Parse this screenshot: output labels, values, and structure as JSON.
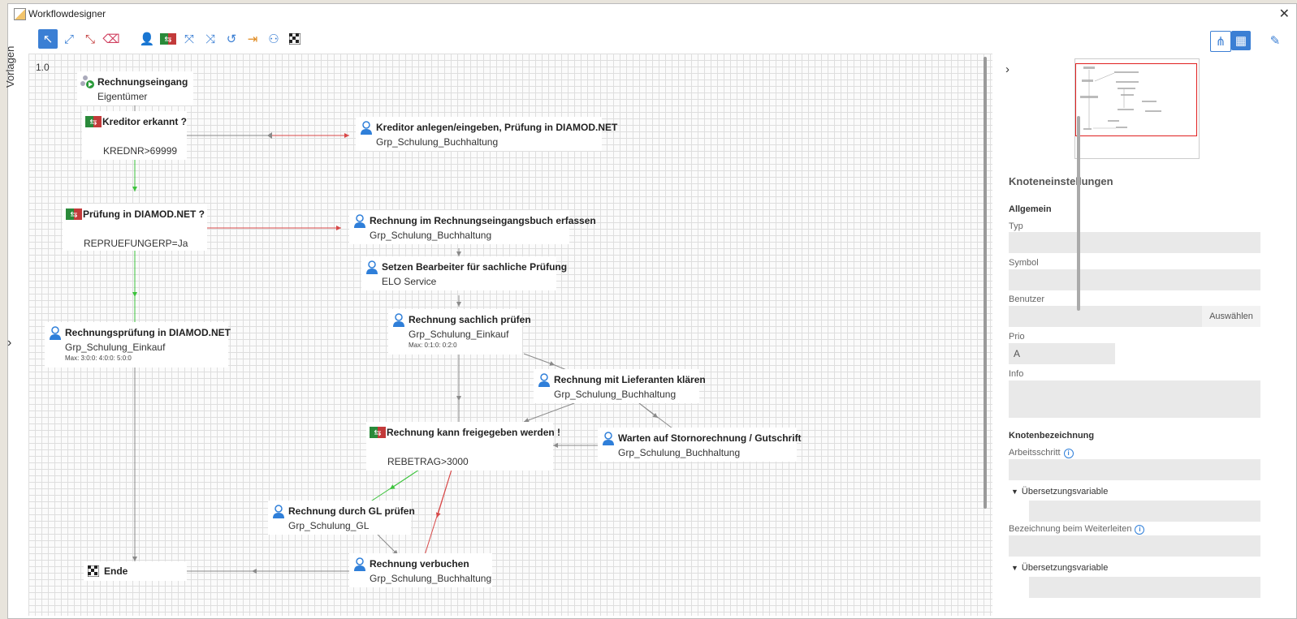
{
  "window": {
    "title": "Workflowdesigner"
  },
  "toolbar": {
    "tools": [
      {
        "name": "select-tool",
        "glyph": "↖",
        "active": true
      },
      {
        "name": "connect-tool",
        "glyph": "⤢"
      },
      {
        "name": "error-connect-tool",
        "glyph": "⤡"
      },
      {
        "name": "eraser-tool",
        "glyph": "⌫"
      },
      {
        "name": "person-node-tool",
        "glyph": "👤"
      },
      {
        "name": "decision-node-tool",
        "glyph": "⇆"
      },
      {
        "name": "split-node-tool",
        "glyph": "⤧"
      },
      {
        "name": "join-node-tool",
        "glyph": "⤨"
      },
      {
        "name": "loop-node-tool",
        "glyph": "↺"
      },
      {
        "name": "subworkflow-node-tool",
        "glyph": "⇥"
      },
      {
        "name": "distribution-node-tool",
        "glyph": "⚇"
      },
      {
        "name": "end-node-tool",
        "glyph": "⚑"
      }
    ],
    "right_tools": [
      {
        "name": "layout-tree-button",
        "glyph": "⋔",
        "active": false
      },
      {
        "name": "grid-toggle-button",
        "glyph": "▦",
        "active": true
      },
      {
        "name": "edit-settings-button",
        "glyph": "✎",
        "active": false
      }
    ]
  },
  "side_tab": "Vorlagen",
  "canvas": {
    "version": "1.0",
    "nodes": {
      "n1": {
        "title": "Rechnungseingang",
        "sub": "Eigentümer",
        "icon": "start"
      },
      "n2": {
        "title": "Kreditor erkannt ?",
        "cond": "KREDNR>69999",
        "icon": "decision"
      },
      "n3": {
        "title": "Kreditor anlegen/eingeben, Prüfung in DIAMOD.NET",
        "sub": "Grp_Schulung_Buchhaltung",
        "icon": "person"
      },
      "n4": {
        "title": "Prüfung in DIAMOD.NET ?",
        "cond": "REPRUEFUNGERP=Ja",
        "icon": "decision"
      },
      "n5": {
        "title": "Rechnung im Rechnungseingangsbuch erfassen",
        "sub": "Grp_Schulung_Buchhaltung",
        "icon": "person"
      },
      "n6": {
        "title": "Setzen Bearbeiter für sachliche Prüfung",
        "sub": "ELO Service",
        "icon": "person"
      },
      "n7": {
        "title": "Rechnungsprüfung in DIAMOD.NET",
        "sub": "Grp_Schulung_Einkauf",
        "meta": "Max: 3:0:0: 4:0:0: 5:0:0",
        "icon": "person"
      },
      "n8": {
        "title": "Rechnung sachlich prüfen",
        "sub": "Grp_Schulung_Einkauf",
        "meta": "Max: 0:1:0: 0:2:0",
        "icon": "person"
      },
      "n9": {
        "title": "Rechnung mit Lieferanten klären",
        "sub": "Grp_Schulung_Buchhaltung",
        "icon": "person"
      },
      "n10": {
        "title": "Rechnung kann freigegeben werden !",
        "cond": "REBETRAG>3000",
        "icon": "decision"
      },
      "n11": {
        "title": "Warten auf Stornorechnung / Gutschrift",
        "sub": "Grp_Schulung_Buchhaltung",
        "icon": "person"
      },
      "n12": {
        "title": "Rechnung durch GL prüfen",
        "sub": "Grp_Schulung_GL",
        "icon": "person"
      },
      "n13": {
        "title": "Rechnung verbuchen",
        "sub": "Grp_Schulung_Buchhaltung",
        "icon": "person"
      },
      "n14": {
        "title": "Ende",
        "icon": "end"
      }
    }
  },
  "panel": {
    "heading": "Knoteneinstellungen",
    "general": "Allgemein",
    "type_label": "Typ",
    "type_value": "",
    "symbol_label": "Symbol",
    "symbol_value": "",
    "user_label": "Benutzer",
    "user_value": "",
    "user_button": "Auswählen",
    "prio_label": "Prio",
    "prio_value": "A",
    "info_label": "Info",
    "info_value": "",
    "node_naming": "Knotenbezeichnung",
    "step_label": "Arbeitsschritt",
    "step_value": "",
    "translation_label": "Übersetzungsvariable",
    "forward_label": "Bezeichnung beim Weiterleiten",
    "forward_value": "",
    "translation_label_2": "Übersetzungsvariable"
  },
  "colors": {
    "accent": "#3b7fd4",
    "edge_default": "#8a8a8a",
    "edge_true": "#3cc33c",
    "edge_false": "#d84848",
    "minimap_viewport": "#e02020"
  }
}
